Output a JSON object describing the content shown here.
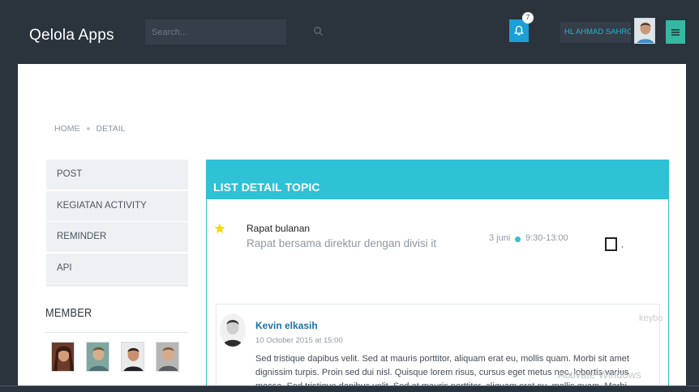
{
  "app": {
    "title": "Qelola Apps"
  },
  "search": {
    "placeholder": "Search..."
  },
  "notifications": {
    "count": "7"
  },
  "user": {
    "name": "HL AHMAD SAHROJI"
  },
  "breadcrumb": {
    "items": [
      "HOME",
      "DETAIL"
    ]
  },
  "sidebar": {
    "items": [
      {
        "label": "POST"
      },
      {
        "label": "KEGIATAN ACTIVITY"
      },
      {
        "label": "REMINDER"
      },
      {
        "label": "API"
      }
    ]
  },
  "members": {
    "title": "MEMBER"
  },
  "card": {
    "title": "LIST DETAIL TOPIC",
    "topic": {
      "title": "Rapat bulanan",
      "description": "Rapat bersama direktur dengan divisi it",
      "date": "3 juni",
      "time": "9:30-13:00",
      "trailing": ","
    },
    "comment": {
      "author": "Kevin elkasih",
      "date": "10 October 2015 at 15:00",
      "body": "Sed tristique dapibus velit. Sed at mauris porttitor, aliquam erat eu, mollis quam. Morbi sit amet dignissim turpis. Proin sed dui nisl. Quisque lorem risus, cursus eget metus nec, lobortis varius massa. Sed tristique dapibus velit. Sed at mauris porttitor, aliquam erat eu, mollis quam. Morbi sit"
    }
  },
  "watermark": {
    "line1": "keybo",
    "line2": "Activate Windows"
  },
  "colors": {
    "topbar": "#2b333d",
    "accent": "#2fc1d5",
    "bell": "#1b9fd4",
    "menu": "#36b7a3",
    "link": "#1e6fa8",
    "star": "#f5d90a"
  },
  "icons": {
    "search": "search-icon",
    "bell": "bell-icon",
    "menu": "hamburger-icon",
    "star": "star-icon",
    "checkbox": "checkbox-icon"
  }
}
